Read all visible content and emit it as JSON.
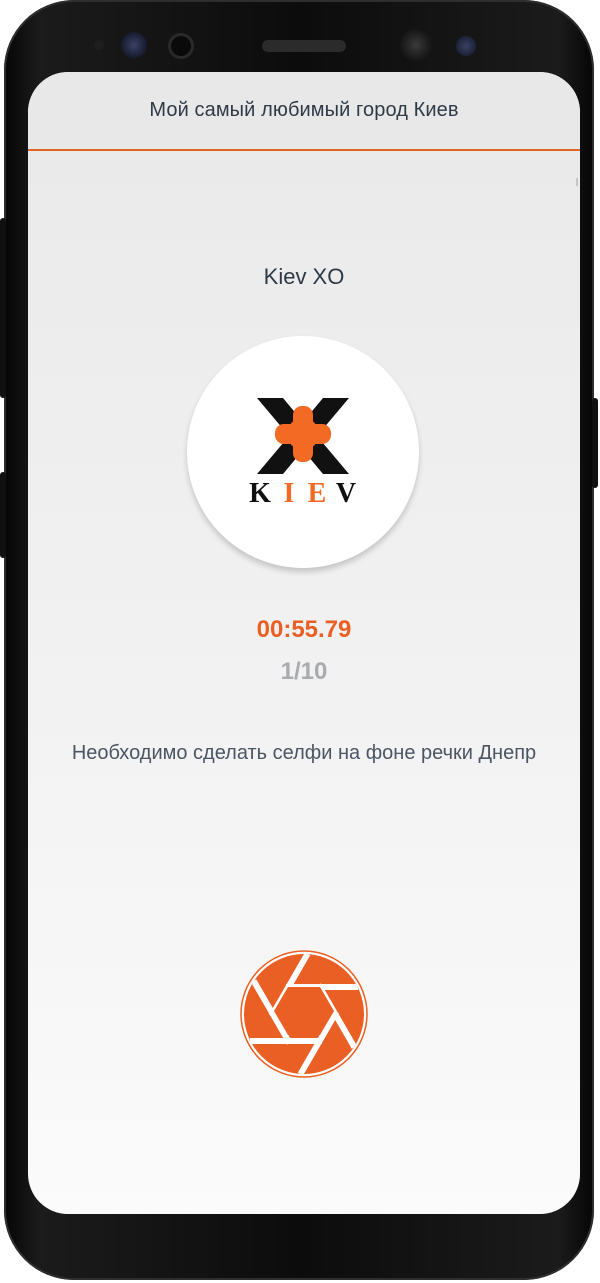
{
  "header": {
    "title": "Мой самый любимый город Киев"
  },
  "quest": {
    "title": "Kiev XO",
    "logo": {
      "icon": "kiev-xo-logo",
      "letters": [
        "K",
        "I",
        "E",
        "V"
      ]
    }
  },
  "timer": "00:55.79",
  "progress": {
    "text": "1/10",
    "current": 1,
    "total": 10
  },
  "task": "Необходимо сделать селфи на фоне речки Днепр",
  "camera_button": {
    "icon": "camera-shutter-icon"
  },
  "colors": {
    "accent": "#ea5f24",
    "text": "#2f3a47",
    "muted": "#a9abae"
  }
}
